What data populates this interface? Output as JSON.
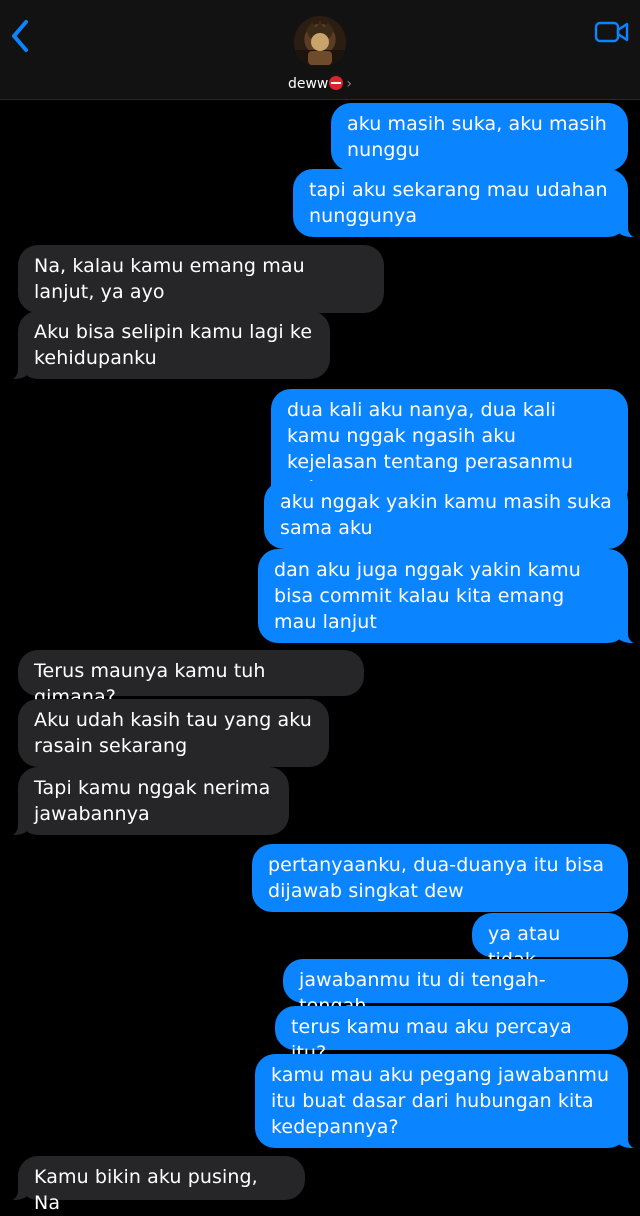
{
  "header": {
    "contact_name": "deww",
    "contact_emoji": "no-entry-emoji",
    "back_icon": "chevron-left-icon",
    "video_icon": "video-camera-icon",
    "accent_color": "#0a84ff"
  },
  "messages": [
    {
      "sender": "me",
      "text": "aku masih suka, aku masih nunggu"
    },
    {
      "sender": "me",
      "text": "tapi aku sekarang mau udahan nunggunya"
    },
    {
      "sender": "them",
      "text": "Na, kalau kamu emang mau lanjut, ya ayo"
    },
    {
      "sender": "them",
      "text": "Aku bisa selipin kamu lagi ke kehidupanku"
    },
    {
      "sender": "me",
      "text": "dua kali aku nanya, dua kali kamu nggak ngasih aku kejelasan tentang perasanmu sekarang"
    },
    {
      "sender": "me",
      "text": "aku nggak yakin kamu masih suka sama aku"
    },
    {
      "sender": "me",
      "text": "dan aku juga nggak yakin kamu bisa commit kalau kita emang mau lanjut"
    },
    {
      "sender": "them",
      "text": "Terus maunya kamu tuh gimana?"
    },
    {
      "sender": "them",
      "text": "Aku udah kasih tau yang aku rasain sekarang"
    },
    {
      "sender": "them",
      "text": "Tapi kamu nggak nerima jawabannya"
    },
    {
      "sender": "me",
      "text": "pertanyaanku, dua-duanya itu bisa dijawab singkat dew"
    },
    {
      "sender": "me",
      "text": "ya atau tidak"
    },
    {
      "sender": "me",
      "text": "jawabanmu itu di tengah-tengah"
    },
    {
      "sender": "me",
      "text": "terus kamu mau aku percaya itu?"
    },
    {
      "sender": "me",
      "text": "kamu mau aku pegang jawabanmu itu buat dasar dari hubungan kita kedepannya?"
    },
    {
      "sender": "them",
      "text": "Kamu bikin aku pusing, Na"
    }
  ]
}
